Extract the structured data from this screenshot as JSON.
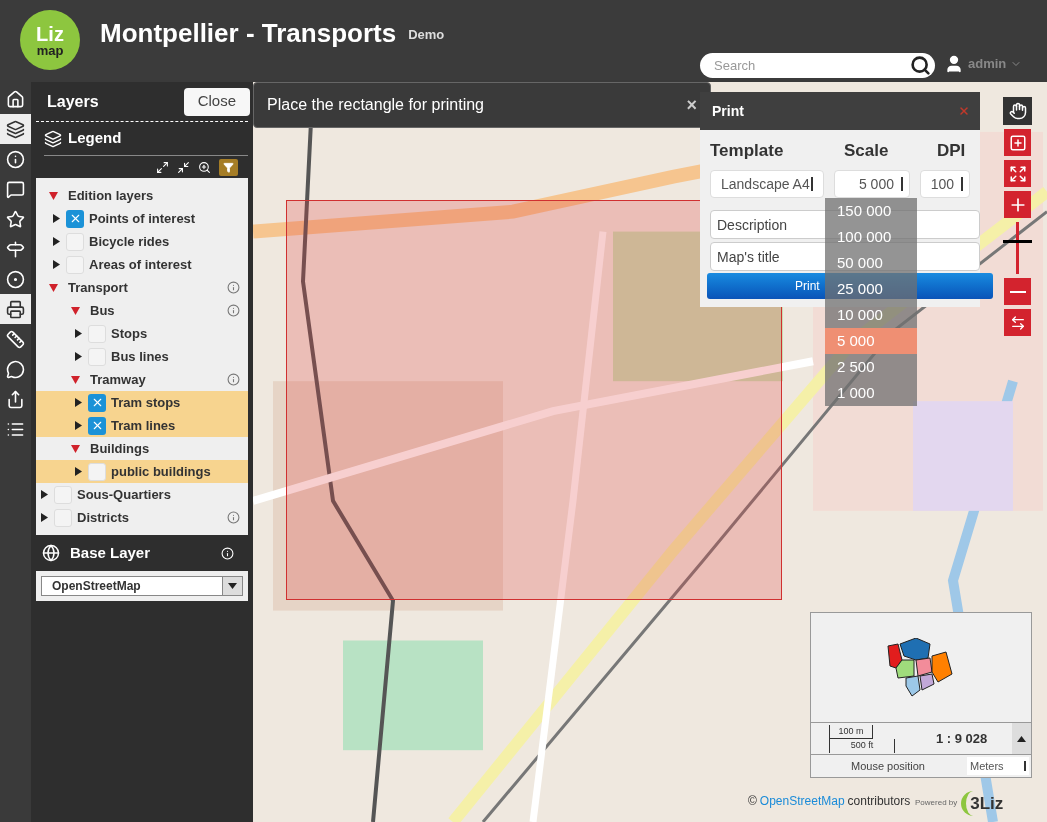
{
  "header": {
    "logo": {
      "top": "Liz",
      "bottom": "map"
    },
    "title": "Montpellier - Transports",
    "subtitle": "Demo",
    "search": {
      "placeholder": "Search"
    },
    "user": "admin"
  },
  "toolbar": [
    {
      "kind": "home",
      "selected": false
    },
    {
      "kind": "layers",
      "selected": true
    },
    {
      "kind": "info",
      "selected": false
    },
    {
      "kind": "comment",
      "selected": false
    },
    {
      "kind": "star",
      "selected": false
    },
    {
      "kind": "signpost",
      "selected": false
    },
    {
      "kind": "target",
      "selected": false
    },
    {
      "kind": "print",
      "selected": true
    },
    {
      "kind": "measure",
      "selected": false
    },
    {
      "kind": "chat",
      "selected": false
    },
    {
      "kind": "share",
      "selected": false
    },
    {
      "kind": "list",
      "selected": false
    }
  ],
  "layers_panel": {
    "title": "Layers",
    "close": "Close",
    "legend": "Legend",
    "tree": [
      {
        "kind": "group",
        "label": "Edition layers",
        "expanded": true,
        "info": false,
        "children": [
          {
            "kind": "layer",
            "label": "Points of interest",
            "checked": true,
            "highlighted": false,
            "info": false
          },
          {
            "kind": "layer",
            "label": "Bicycle rides",
            "checked": false,
            "highlighted": false,
            "info": false
          },
          {
            "kind": "layer",
            "label": "Areas of interest",
            "checked": false,
            "highlighted": false,
            "info": false
          }
        ]
      },
      {
        "kind": "group",
        "label": "Transport",
        "expanded": true,
        "info": true,
        "children": [
          {
            "kind": "group",
            "label": "Bus",
            "expanded": true,
            "info": true,
            "children": [
              {
                "kind": "layer",
                "label": "Stops",
                "checked": false,
                "highlighted": false,
                "info": false
              },
              {
                "kind": "layer",
                "label": "Bus lines",
                "checked": false,
                "highlighted": false,
                "info": false
              }
            ]
          },
          {
            "kind": "group",
            "label": "Tramway",
            "expanded": true,
            "info": true,
            "children": [
              {
                "kind": "layer",
                "label": "Tram stops",
                "checked": true,
                "highlighted": true,
                "info": false
              },
              {
                "kind": "layer",
                "label": "Tram lines",
                "checked": true,
                "highlighted": true,
                "info": false
              }
            ]
          },
          {
            "kind": "group",
            "label": "Buildings",
            "expanded": true,
            "info": false,
            "children": [
              {
                "kind": "layer",
                "label": "public buildings",
                "checked": false,
                "highlighted": true,
                "info": false
              }
            ]
          }
        ]
      },
      {
        "kind": "layer",
        "label": "Sous-Quartiers",
        "checked": false,
        "highlighted": false,
        "info": false
      },
      {
        "kind": "layer",
        "label": "Districts",
        "checked": false,
        "highlighted": false,
        "info": true
      }
    ],
    "base_layer": {
      "title": "Base Layer",
      "value": "OpenStreetMap"
    }
  },
  "print_toast": {
    "text": "Place the rectangle for printing",
    "close": "×"
  },
  "print_panel": {
    "title": "Print",
    "headers": [
      "Template",
      "Scale",
      "DPI"
    ],
    "template": "Landscape A4",
    "scale": "5 000",
    "dpi": "100",
    "description": {
      "placeholder": "Description"
    },
    "map_title": {
      "placeholder": "Map's title"
    },
    "button": "Print",
    "scale_options": [
      {
        "label": "150 000",
        "selected": false
      },
      {
        "label": "100 000",
        "selected": false
      },
      {
        "label": "50 000",
        "selected": false
      },
      {
        "label": "25 000",
        "selected": false
      },
      {
        "label": "10 000",
        "selected": false
      },
      {
        "label": "5 000",
        "selected": true
      },
      {
        "label": "2 500",
        "selected": false
      },
      {
        "label": "1 000",
        "selected": false
      }
    ]
  },
  "zoom_slider": {
    "level": 0.6
  },
  "overview": {
    "scale_bar": [
      "100 m",
      "500 ft"
    ],
    "scale": "1 : 9 028",
    "mouse_position": "Mouse position",
    "units": "Meters"
  },
  "attribution": {
    "prefix": "©",
    "link": "OpenStreetMap",
    "suffix": "contributors",
    "powered": "Powered by",
    "brand": "3Liz"
  }
}
